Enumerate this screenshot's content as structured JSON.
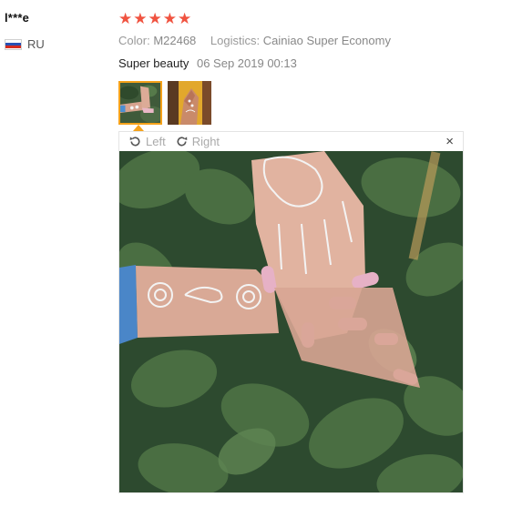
{
  "reviewer": {
    "name": "l***e",
    "country_code": "RU",
    "flag_colors": [
      "#ffffff",
      "#2850b4",
      "#d52b1e"
    ]
  },
  "rating": {
    "value": 5,
    "max": 5,
    "star_color": "#f05340"
  },
  "meta": {
    "color_label": "Color:",
    "color_value": "M22468",
    "logistics_label": "Logistics:",
    "logistics_value": "Cainiao Super Economy"
  },
  "review": {
    "text": "Super beauty",
    "date": "06 Sep 2019 00:13"
  },
  "thumbnails": [
    {
      "name": "hands-with-henna-on-leaves",
      "active": true
    },
    {
      "name": "hand-with-henna-on-yellow",
      "active": false
    }
  ],
  "viewer": {
    "rotate_left_label": "Left",
    "rotate_right_label": "Right",
    "close_symbol": "×",
    "accent_color": "#f5a21a"
  }
}
